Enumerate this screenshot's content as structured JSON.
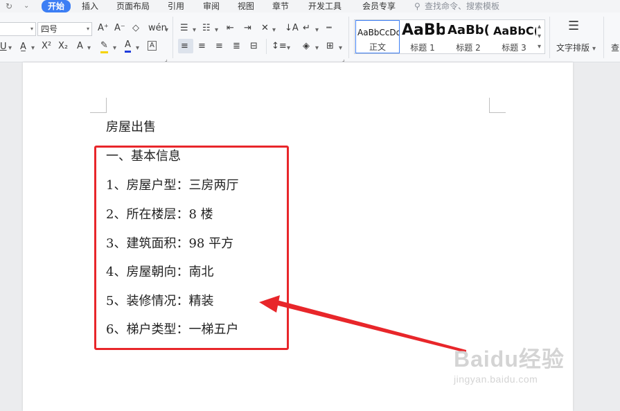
{
  "menubar": {
    "items": [
      "开始",
      "插入",
      "页面布局",
      "引用",
      "审阅",
      "视图",
      "章节",
      "开发工具",
      "会员专享"
    ],
    "search_placeholder": "查找命令、搜索模板"
  },
  "ribbon": {
    "font_size": "四号",
    "font_color": "#1f3bdc",
    "highlight_color": "#f5d300",
    "styles": [
      {
        "preview": "AaBbCcDd",
        "name": "正文"
      },
      {
        "preview": "AaBb",
        "name": "标题 1"
      },
      {
        "preview": "AaBb(",
        "name": "标题 2"
      },
      {
        "preview": "AaBbC(",
        "name": "标题 3"
      }
    ],
    "text_layout_label": "文字排版",
    "cut_label": "查"
  },
  "document": {
    "lines": [
      "房屋出售",
      "一、基本信息",
      "1、房屋户型：三房两厅",
      "2、所在楼层：8 楼",
      "3、建筑面积：98 平方",
      "4、房屋朝向：南北",
      "5、装修情况：精装",
      "6、梯户类型：一梯五户"
    ]
  },
  "annotation": {
    "box_color": "#e8262a",
    "arrow_color": "#e8262a"
  },
  "watermark": {
    "logo": "Baidu经验",
    "url": "jingyan.baidu.com"
  }
}
